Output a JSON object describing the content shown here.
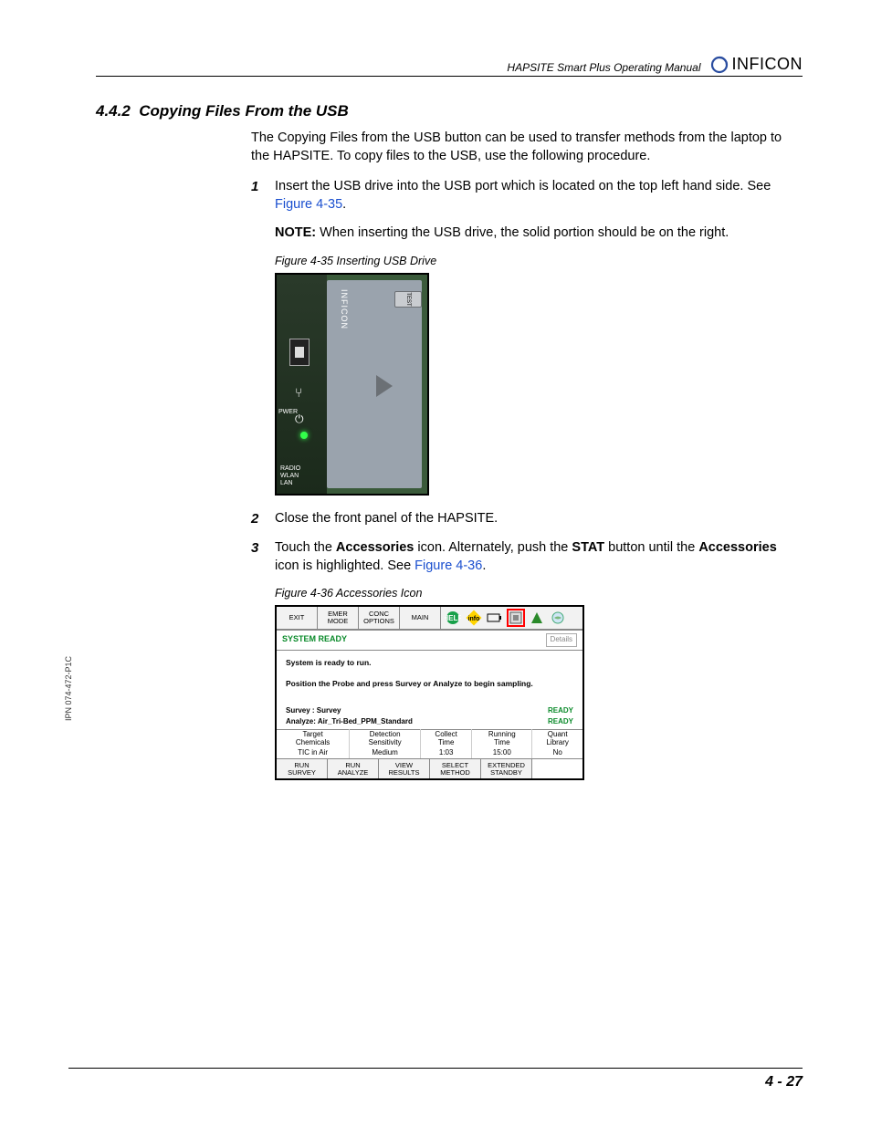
{
  "header": {
    "manual_title": "HAPSITE Smart Plus Operating Manual",
    "brand": "INFICON"
  },
  "section": {
    "number": "4.4.2",
    "title": "Copying Files From the USB"
  },
  "intro": "The Copying Files from the USB button can be used to transfer methods from the laptop to the HAPSITE. To copy files to the USB, use the following procedure.",
  "steps": {
    "s1": {
      "num": "1",
      "text_a": "Insert the USB drive into the USB port which is located on the top left hand side. See ",
      "link": "Figure 4-35",
      "text_b": "."
    },
    "note": {
      "label": "NOTE:",
      "text": "When inserting the USB drive, the solid portion should be on the right."
    },
    "s2": {
      "num": "2",
      "text": "Close the front panel of the HAPSITE."
    },
    "s3": {
      "num": "3",
      "pre": "Touch the ",
      "b1": "Accessories",
      "mid1": " icon. Alternately, push the ",
      "b2": "STAT",
      "mid2": " button until the ",
      "b3": "Accessories",
      "post": " icon is highlighted. See ",
      "link": "Figure 4-36",
      "end": "."
    }
  },
  "fig35": {
    "caption": "Figure 4-35  Inserting USB Drive",
    "brand": "INFICON",
    "test": "TEST",
    "pwr": "PWER",
    "labels": {
      "radio": "RADIO",
      "wlan": "WLAN",
      "lan": "LAN"
    }
  },
  "fig36": {
    "caption": "Figure 4-36  Accessories Icon",
    "top_buttons": {
      "exit": "EXIT",
      "emer": "EMER\nMODE",
      "conc": "CONC\nOPTIONS",
      "main": "MAIN"
    },
    "system_ready": "SYSTEM READY",
    "details": "Details",
    "msg1": "System is ready to run.",
    "msg2": "Position the Probe and press Survey or Analyze to begin sampling.",
    "survey_label": "Survey  : Survey",
    "analyze_label": "Analyze: Air_Tri-Bed_PPM_Standard",
    "ready": "READY",
    "table": {
      "h": [
        "Target\nChemicals",
        "Detection\nSensitivity",
        "Collect\nTime",
        "Running\nTime",
        "Quant\nLibrary"
      ],
      "r": [
        "TIC in Air",
        "Medium",
        "1:03",
        "15:00",
        "No"
      ]
    },
    "buttons": {
      "b1": "RUN\nSURVEY",
      "b2": "RUN\nANALYZE",
      "b3": "VIEW\nRESULTS",
      "b4": "SELECT\nMETHOD",
      "b5": "EXTENDED\nSTANDBY",
      "b6": ""
    }
  },
  "side_note": "IPN 074-472-P1C",
  "footer": "4 - 27"
}
